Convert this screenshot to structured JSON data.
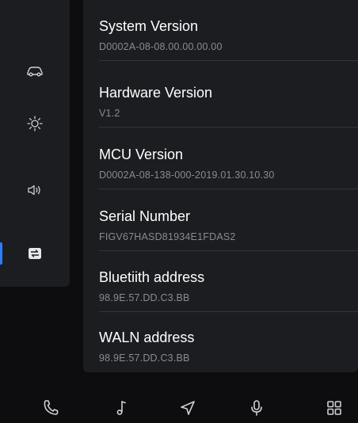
{
  "sidebar": {
    "items": [
      {
        "icon": "car-icon",
        "active": false
      },
      {
        "icon": "brightness-icon",
        "active": false
      },
      {
        "icon": "volume-icon",
        "active": false
      },
      {
        "icon": "system-settings-icon",
        "active": true
      }
    ]
  },
  "info": {
    "items": [
      {
        "label": "System Version",
        "value": "D0002A-08-08.00.00.00.00"
      },
      {
        "label": "Hardware Version",
        "value": "V1.2"
      },
      {
        "label": "MCU Version",
        "value": "D0002A-08-138-000-2019.01.30.10.30"
      },
      {
        "label": "Serial Number",
        "value": "FIGV67HASD81934E1FDAS2"
      },
      {
        "label": "Bluetiith address",
        "value": "98.9E.57.DD.C3.BB"
      },
      {
        "label": "WALN address",
        "value": "98.9E.57.DD.C3.BB"
      }
    ]
  },
  "bottom_nav": {
    "items": [
      {
        "icon": "phone-icon"
      },
      {
        "icon": "music-icon"
      },
      {
        "icon": "navigation-icon"
      },
      {
        "icon": "microphone-icon"
      },
      {
        "icon": "apps-grid-icon"
      }
    ]
  },
  "colors": {
    "accent": "#2e7cf6",
    "panel": "#1c1d21",
    "background": "#0d0d0f",
    "secondary_text": "#8a8b90"
  }
}
